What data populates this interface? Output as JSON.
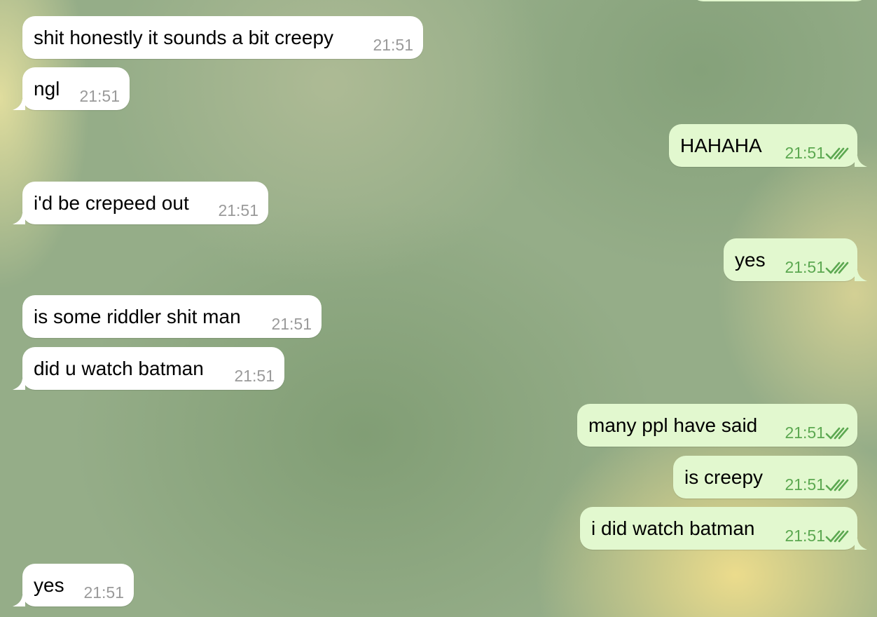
{
  "messages": [
    {
      "id": "m1",
      "direction": "in",
      "text": "shit honestly it sounds a bit creepy",
      "time": "21:51"
    },
    {
      "id": "m2",
      "direction": "in",
      "text": "ngl",
      "time": "21:51"
    },
    {
      "id": "m3",
      "direction": "out",
      "text": "HAHAHA",
      "time": "21:51",
      "status": "read"
    },
    {
      "id": "m4",
      "direction": "in",
      "text": "i'd be crepeed out",
      "time": "21:51"
    },
    {
      "id": "m5",
      "direction": "out",
      "text": "yes",
      "time": "21:51",
      "status": "read"
    },
    {
      "id": "m6",
      "direction": "in",
      "text": "is some riddler shit man",
      "time": "21:51"
    },
    {
      "id": "m7",
      "direction": "in",
      "text": "did u watch batman",
      "time": "21:51"
    },
    {
      "id": "m8",
      "direction": "out",
      "text": "many ppl have said",
      "time": "21:51",
      "status": "read"
    },
    {
      "id": "m9",
      "direction": "out",
      "text": "is creepy",
      "time": "21:51",
      "status": "read"
    },
    {
      "id": "m10",
      "direction": "out",
      "text": "i did watch batman",
      "time": "21:51",
      "status": "read"
    },
    {
      "id": "m11",
      "direction": "in",
      "text": "yes",
      "time": "21:51"
    }
  ],
  "colors": {
    "incoming_bubble": "#ffffff",
    "outgoing_bubble": "#e2f8cf",
    "incoming_time": "#9a9a9a",
    "outgoing_time": "#5ca851",
    "read_ticks": "#5ca851"
  },
  "icons": {
    "read_status": "double-check-icon"
  }
}
